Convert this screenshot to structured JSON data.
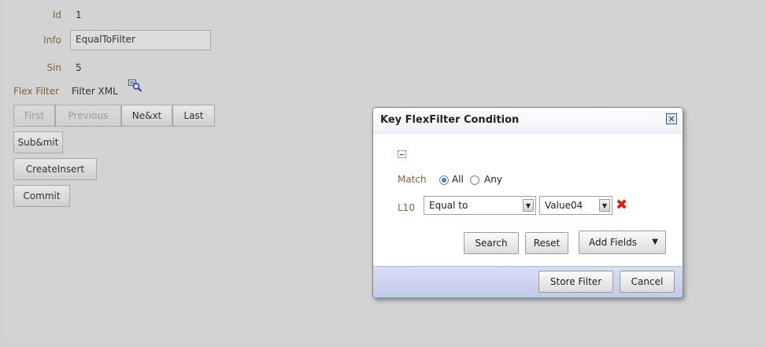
{
  "form": {
    "id_label": "Id",
    "id_value": "1",
    "info_label": "Info",
    "info_value": "EqualToFilter",
    "sin_label": "Sin",
    "sin_value": "5",
    "flex_filter_label": "Flex Filter",
    "filter_xml_text": "Filter XML"
  },
  "nav": {
    "first": "First",
    "previous": "Previous",
    "next": "Ne&xt",
    "last": "Last"
  },
  "actions": {
    "submit": "Sub&mit",
    "create_insert": "CreateInsert",
    "commit": "Commit"
  },
  "dialog": {
    "title": "Key FlexFilter Condition",
    "close_symbol": "✕",
    "match_label": "Match",
    "match_all": "All",
    "match_any": "Any",
    "match_selected": "All",
    "row_label": "L10",
    "operator": "Equal to",
    "value": "Value04",
    "search": "Search",
    "reset": "Reset",
    "add_fields": "Add Fields",
    "store_filter": "Store Filter",
    "cancel": "Cancel"
  },
  "icons": {
    "filter_xml": "magnifier-filter-icon",
    "expand": "expand-icon",
    "remove": "remove-icon"
  }
}
